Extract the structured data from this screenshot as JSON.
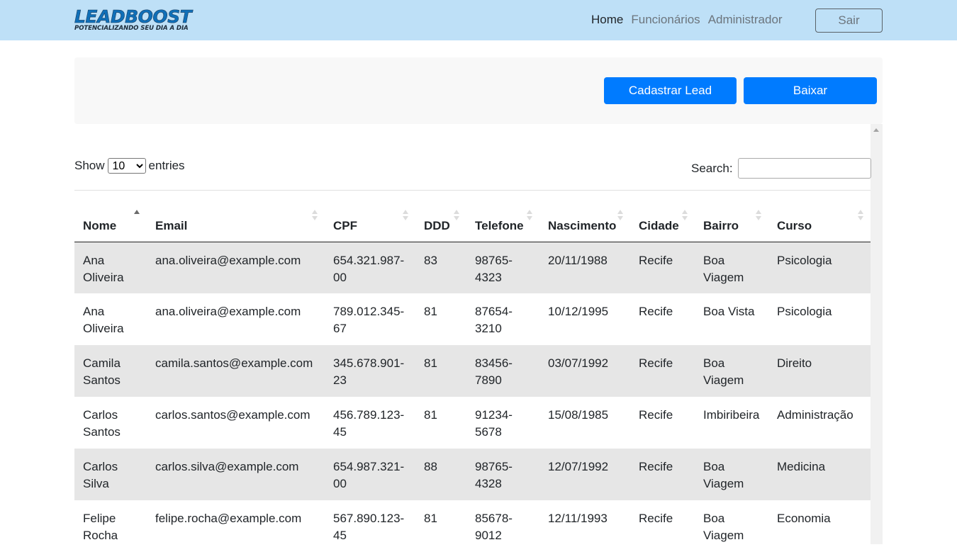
{
  "brand": {
    "title": "LEADBOOST",
    "tagline": "POTENCIALIZANDO SEU DIA A DIA"
  },
  "nav": {
    "items": [
      {
        "label": "Home"
      },
      {
        "label": "Funcionários"
      },
      {
        "label": "Administrador"
      }
    ],
    "logout_label": "Sair"
  },
  "actions": {
    "register_label": "Cadastrar Lead",
    "download_label": "Baixar"
  },
  "table_controls": {
    "show_label": "Show",
    "entries_label": "entries",
    "page_length_options": [
      "10"
    ],
    "page_length": "10",
    "search_label": "Search:",
    "search_value": ""
  },
  "table": {
    "columns": [
      "Nome",
      "Email",
      "CPF",
      "DDD",
      "Telefone",
      "Nascimento",
      "Cidade",
      "Bairro",
      "Curso"
    ],
    "sorted_column": "Nome",
    "rows": [
      [
        "Ana Oliveira",
        "ana.oliveira@example.com",
        "654.321.987-00",
        "83",
        "98765-4323",
        "20/11/1988",
        "Recife",
        "Boa Viagem",
        "Psicologia"
      ],
      [
        "Ana Oliveira",
        "ana.oliveira@example.com",
        "789.012.345-67",
        "81",
        "87654-3210",
        "10/12/1995",
        "Recife",
        "Boa Vista",
        "Psicologia"
      ],
      [
        "Camila Santos",
        "camila.santos@example.com",
        "345.678.901-23",
        "81",
        "83456-7890",
        "03/07/1992",
        "Recife",
        "Boa Viagem",
        "Direito"
      ],
      [
        "Carlos Santos",
        "carlos.santos@example.com",
        "456.789.123-45",
        "81",
        "91234-5678",
        "15/08/1985",
        "Recife",
        "Imbiribeira",
        "Administração"
      ],
      [
        "Carlos Silva",
        "carlos.silva@example.com",
        "654.987.321-00",
        "88",
        "98765-4328",
        "12/07/1992",
        "Recife",
        "Boa Viagem",
        "Medicina"
      ],
      [
        "Felipe Rocha",
        "felipe.rocha@example.com",
        "567.890.123-45",
        "81",
        "85678-9012",
        "12/11/1993",
        "Recife",
        "Boa Viagem",
        "Economia"
      ]
    ]
  }
}
